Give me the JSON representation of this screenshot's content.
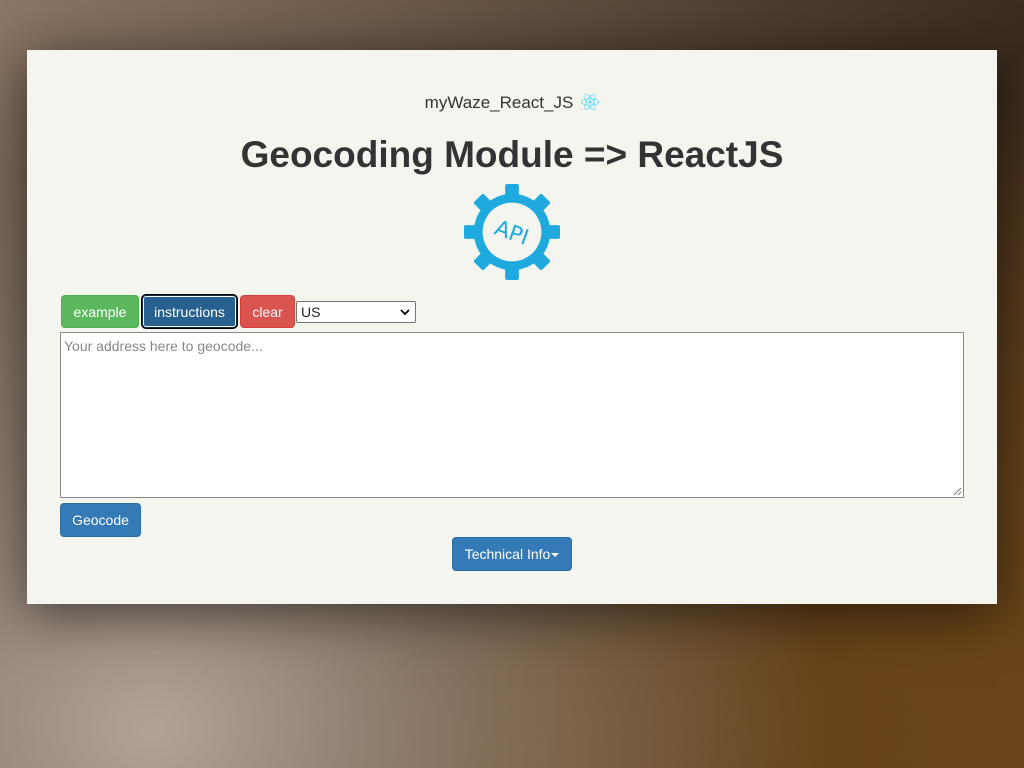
{
  "header": {
    "app_name": "myWaze_React_JS",
    "logo_icon": "react-icon"
  },
  "main": {
    "title": "Geocoding Module => ReactJS",
    "api_logo_text": "API",
    "api_logo_icon": "api-gear-icon"
  },
  "toolbar": {
    "example_label": "example",
    "instructions_label": "instructions",
    "clear_label": "clear",
    "country_selected": "US"
  },
  "address": {
    "value": "",
    "placeholder": "Your address here to geocode..."
  },
  "actions": {
    "geocode_label": "Geocode",
    "tech_info_label": "Technical Info"
  },
  "colors": {
    "success": "#5cb85c",
    "primary": "#337ab7",
    "primary_active": "#286090",
    "danger": "#d9534f",
    "api_logo": "#1eaadf",
    "react_logo": "#61dafb"
  }
}
